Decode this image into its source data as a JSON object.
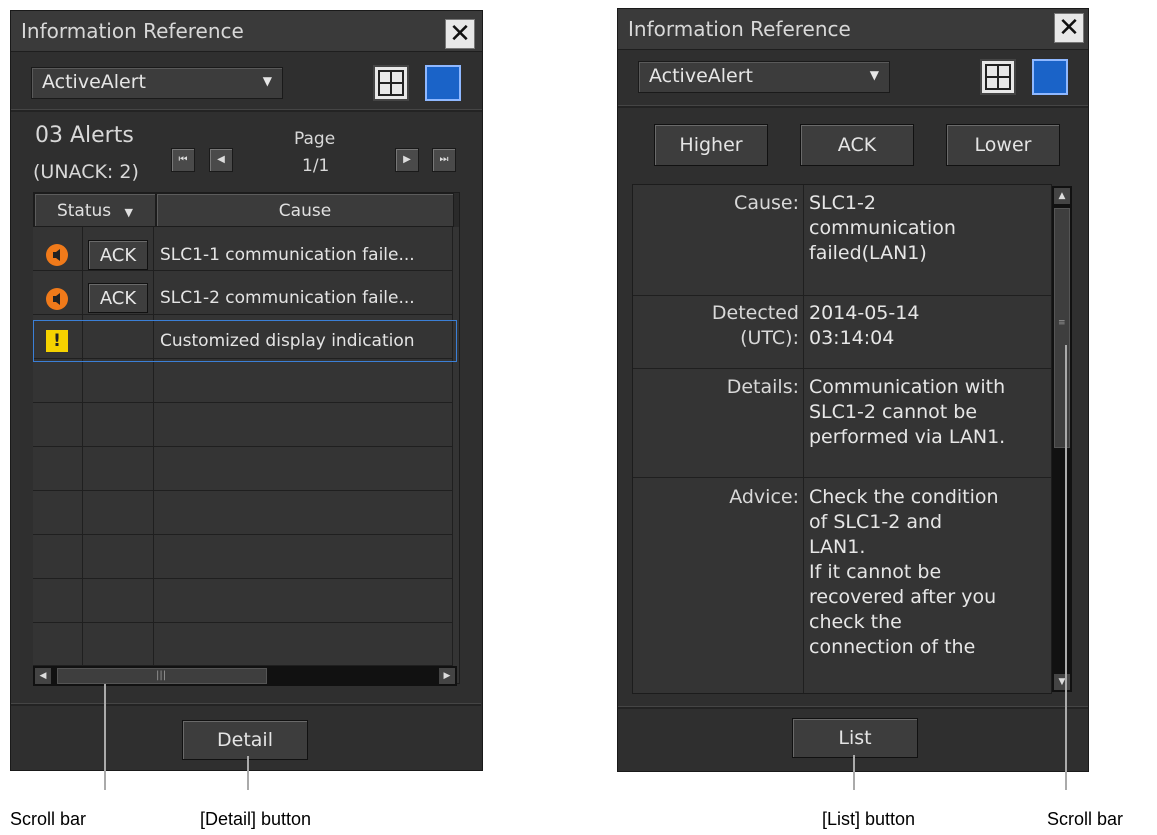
{
  "left_panel": {
    "title": "Information Reference",
    "close": "✕",
    "dropdown": "ActiveAlert",
    "alert_count": "03 Alerts",
    "unack": "(UNACK: 2)",
    "page_label": "Page",
    "page_value": "1/1",
    "columns": [
      "Status",
      "Cause"
    ],
    "rows": [
      {
        "icon": "alarm-icon",
        "ack": "ACK",
        "cause": "SLC1-1 communication faile..."
      },
      {
        "icon": "alarm-icon",
        "ack": "ACK",
        "cause": "SLC1-2 communication faile..."
      },
      {
        "icon": "warning-icon",
        "ack": "",
        "cause": "Customized display indication"
      }
    ],
    "warning_glyph": "!",
    "detail_button": "Detail"
  },
  "right_panel": {
    "title": "Information Reference",
    "close": "✕",
    "dropdown": "ActiveAlert",
    "buttons": {
      "higher": "Higher",
      "ack": "ACK",
      "lower": "Lower"
    },
    "details": {
      "cause_label": "Cause:",
      "cause_lines": [
        "SLC1-2",
        "communication",
        "failed(LAN1)"
      ],
      "detected_label_1": "Detected",
      "detected_label_2": "(UTC):",
      "detected_lines": [
        "2014-05-14",
        "03:14:04"
      ],
      "details_label": "Details:",
      "details_lines": [
        "Communication with",
        "SLC1-2 cannot be",
        "performed via LAN1."
      ],
      "advice_label": "Advice:",
      "advice_lines": [
        "Check the condition",
        "of SLC1-2 and",
        "LAN1.",
        "If it cannot be",
        "recovered after you",
        "check the",
        "connection of the"
      ]
    },
    "list_button": "List"
  },
  "callouts": {
    "left_scroll": "Scroll bar",
    "detail": "[Detail] button",
    "list": "[List] button",
    "right_scroll": "Scroll bar"
  }
}
